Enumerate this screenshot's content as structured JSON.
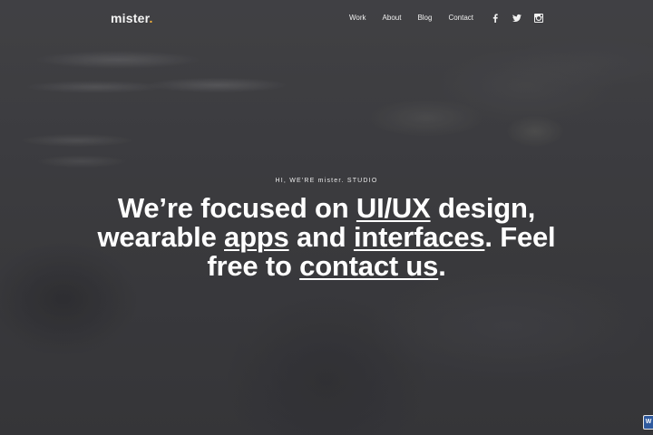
{
  "header": {
    "logo_text": "mister",
    "logo_dot": ".",
    "nav": [
      {
        "label": "Work"
      },
      {
        "label": "About"
      },
      {
        "label": "Blog"
      },
      {
        "label": "Contact"
      }
    ],
    "social": [
      {
        "icon": "facebook-icon"
      },
      {
        "icon": "twitter-icon"
      },
      {
        "icon": "instagram-icon"
      }
    ]
  },
  "hero": {
    "kicker": "HI, WE'RE mister. STUDIO",
    "headline": {
      "part1": "We’re focused on ",
      "link1": "UI/UX",
      "part2": " design, wearable ",
      "link2": "apps",
      "part3": " and ",
      "link3": "interfaces",
      "part4": ". Feel free to ",
      "link4": "contact us",
      "part5": "."
    }
  },
  "corner_badge": {
    "label": "W"
  },
  "colors": {
    "accent": "#f2b13c",
    "text": "#ffffff",
    "overlay": "#3f3f43",
    "badge": "#2f5a9e"
  }
}
